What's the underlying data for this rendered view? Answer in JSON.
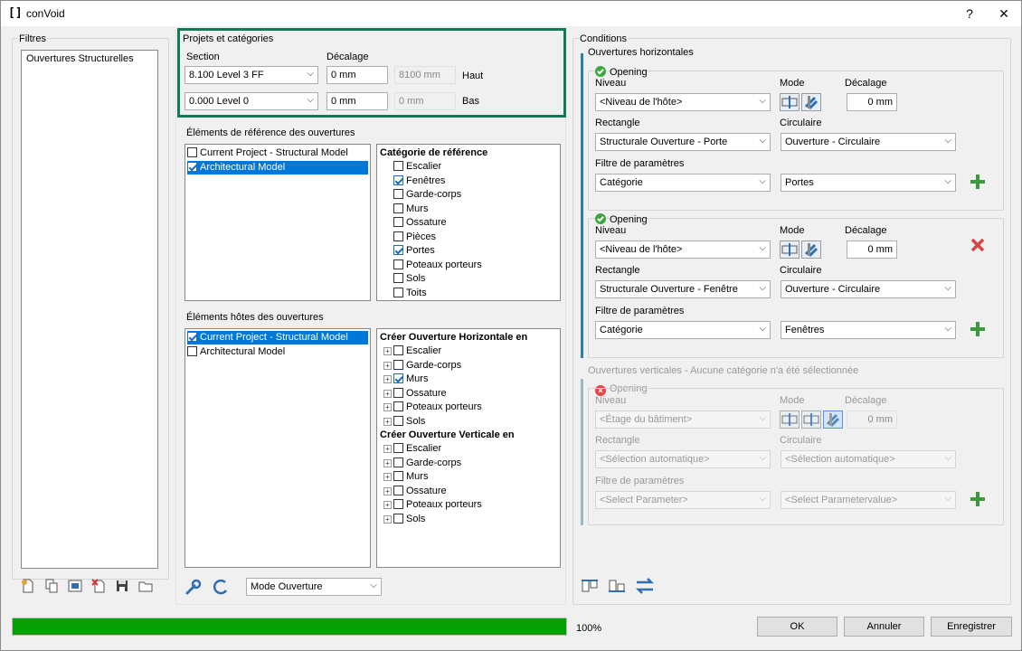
{
  "window": {
    "title": "conVoid",
    "help": "?",
    "close": "✕"
  },
  "filters": {
    "label": "Filtres",
    "items": [
      "Ouvertures Structurelles"
    ]
  },
  "projects": {
    "label": "Projets et catégories",
    "section_label": "Section",
    "offset_label": "Décalage",
    "top": {
      "section": "8.100  Level 3 FF",
      "offset": "0 mm",
      "computed": "8100 mm",
      "side": "Haut"
    },
    "bottom": {
      "section": "0.000  Level 0",
      "offset": "0 mm",
      "computed": "0 mm",
      "side": "Bas"
    }
  },
  "reference": {
    "label": "Éléments de référence des ouvertures",
    "models": [
      {
        "name": "Current Project - Structural Model",
        "checked": false,
        "selected": false
      },
      {
        "name": "Architectural Model",
        "checked": true,
        "selected": true
      }
    ],
    "category_header": "Catégorie de référence",
    "categories": [
      {
        "name": "Escalier",
        "checked": false
      },
      {
        "name": "Fenêtres",
        "checked": true
      },
      {
        "name": "Garde-corps",
        "checked": false
      },
      {
        "name": "Murs",
        "checked": false
      },
      {
        "name": "Ossature",
        "checked": false
      },
      {
        "name": "Pièces",
        "checked": false
      },
      {
        "name": "Portes",
        "checked": true
      },
      {
        "name": "Poteaux porteurs",
        "checked": false
      },
      {
        "name": "Sols",
        "checked": false
      },
      {
        "name": "Toits",
        "checked": false
      }
    ]
  },
  "hosts": {
    "label": "Éléments hôtes des ouvertures",
    "models": [
      {
        "name": "Current Project - Structural Model",
        "checked": true,
        "selected": true
      },
      {
        "name": "Architectural Model",
        "checked": false,
        "selected": false
      }
    ],
    "horizontal_header": "Créer Ouverture Horizontale en",
    "horizontal": [
      {
        "name": "Escalier",
        "checked": false
      },
      {
        "name": "Garde-corps",
        "checked": false
      },
      {
        "name": "Murs",
        "checked": true
      },
      {
        "name": "Ossature",
        "checked": false
      },
      {
        "name": "Poteaux porteurs",
        "checked": false
      },
      {
        "name": "Sols",
        "checked": false
      }
    ],
    "vertical_header": "Créer Ouverture Verticale en",
    "vertical": [
      {
        "name": "Escalier",
        "checked": false
      },
      {
        "name": "Garde-corps",
        "checked": false
      },
      {
        "name": "Murs",
        "checked": false
      },
      {
        "name": "Ossature",
        "checked": false
      },
      {
        "name": "Poteaux porteurs",
        "checked": false
      },
      {
        "name": "Sols",
        "checked": false
      }
    ]
  },
  "mode_select": "Mode Ouverture",
  "conditions": {
    "label": "Conditions",
    "horizontal_label": "Ouvertures horizontales",
    "vertical_label": "Ouvertures verticales - Aucune catégorie n'a été sélectionnée",
    "labels": {
      "niveau": "Niveau",
      "mode": "Mode",
      "decalage": "Décalage",
      "rectangle": "Rectangle",
      "circulaire": "Circulaire",
      "filtre": "Filtre de paramètres"
    },
    "opening1": {
      "title": "Opening",
      "niveau": "<Niveau de l'hôte>",
      "offset": "0 mm",
      "rectangle": "Structurale Ouverture - Porte",
      "circulaire": "Ouverture - Circulaire",
      "param": "Catégorie",
      "value": "Portes"
    },
    "opening2": {
      "title": "Opening",
      "niveau": "<Niveau de l'hôte>",
      "offset": "0 mm",
      "rectangle": "Structurale Ouverture - Fenêtre",
      "circulaire": "Ouverture - Circulaire",
      "param": "Catégorie",
      "value": "Fenêtres"
    },
    "opening3": {
      "title": "Opening",
      "niveau": "<Étage du bâtiment>",
      "offset": "0 mm",
      "rectangle": "<Sélection automatique>",
      "circulaire": "<Sélection automatique>",
      "param": "<Select Parameter>",
      "value": "<Select Parametervalue>"
    }
  },
  "progress": {
    "value": 1.0,
    "label": "100%"
  },
  "buttons": {
    "ok": "OK",
    "cancel": "Annuler",
    "save": "Enregistrer"
  },
  "colors": {
    "accent": "#0078d7",
    "progress": "#06a006",
    "highlight": "#0f7a5a"
  }
}
